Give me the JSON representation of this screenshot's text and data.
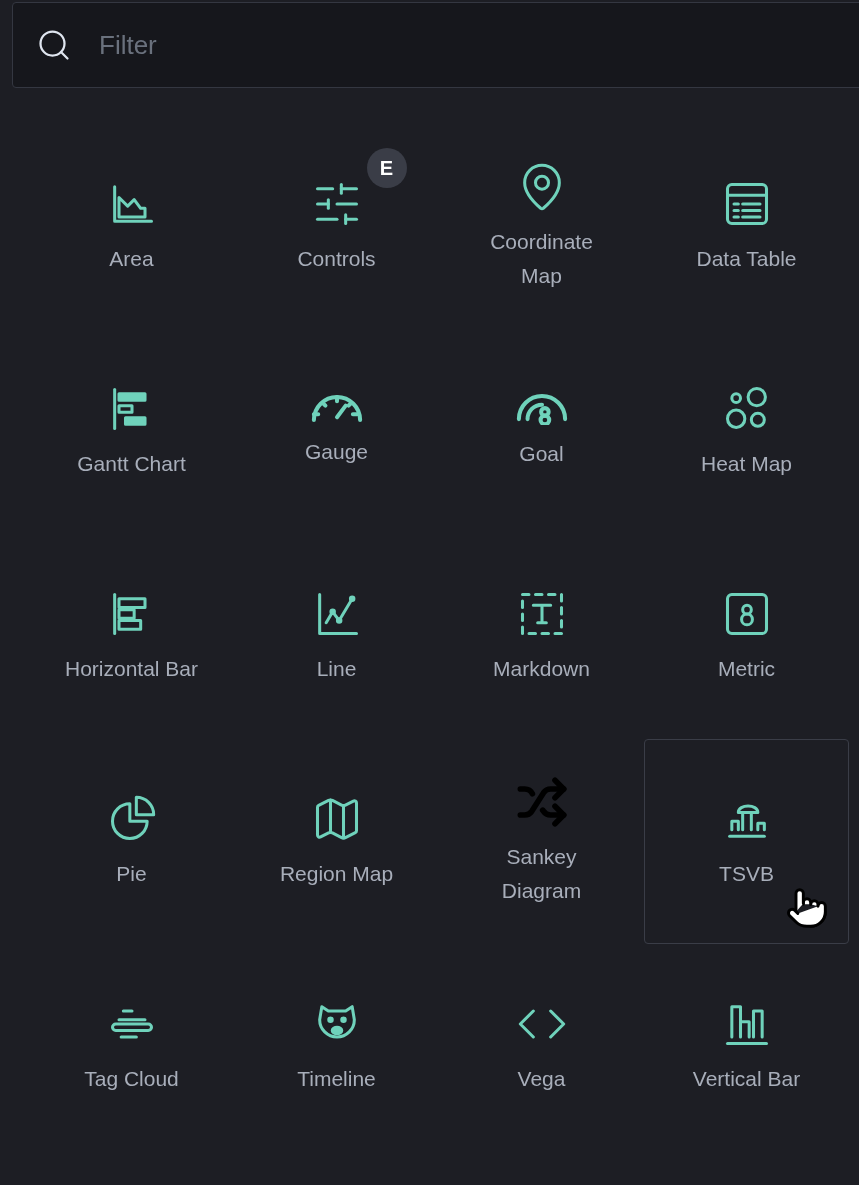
{
  "filter": {
    "placeholder": "Filter"
  },
  "items": [
    {
      "label": "Area",
      "kind": "area",
      "selected": false
    },
    {
      "label": "Controls",
      "kind": "controls",
      "selected": false,
      "badge": "E"
    },
    {
      "label": "Coordinate\nMap",
      "kind": "pin",
      "selected": false
    },
    {
      "label": "Data Table",
      "kind": "table",
      "selected": false
    },
    {
      "label": "Gantt Chart",
      "kind": "gantt",
      "selected": false
    },
    {
      "label": "Gauge",
      "kind": "gauge",
      "selected": false
    },
    {
      "label": "Goal",
      "kind": "goal",
      "selected": false
    },
    {
      "label": "Heat Map",
      "kind": "heatmap",
      "selected": false
    },
    {
      "label": "Horizontal Bar",
      "kind": "hbar",
      "selected": false
    },
    {
      "label": "Line",
      "kind": "line",
      "selected": false
    },
    {
      "label": "Markdown",
      "kind": "markdown",
      "selected": false
    },
    {
      "label": "Metric",
      "kind": "metric",
      "selected": false
    },
    {
      "label": "Pie",
      "kind": "pie",
      "selected": false
    },
    {
      "label": "Region Map",
      "kind": "map",
      "selected": false
    },
    {
      "label": "Sankey\nDiagram",
      "kind": "shuffle",
      "selected": false
    },
    {
      "label": "TSVB",
      "kind": "tsvb",
      "selected": true
    },
    {
      "label": "Tag Cloud",
      "kind": "tagcloud",
      "selected": false
    },
    {
      "label": "Timeline",
      "kind": "bear",
      "selected": false
    },
    {
      "label": "Vega",
      "kind": "code",
      "selected": false
    },
    {
      "label": "Vertical Bar",
      "kind": "vbar",
      "selected": false
    }
  ]
}
